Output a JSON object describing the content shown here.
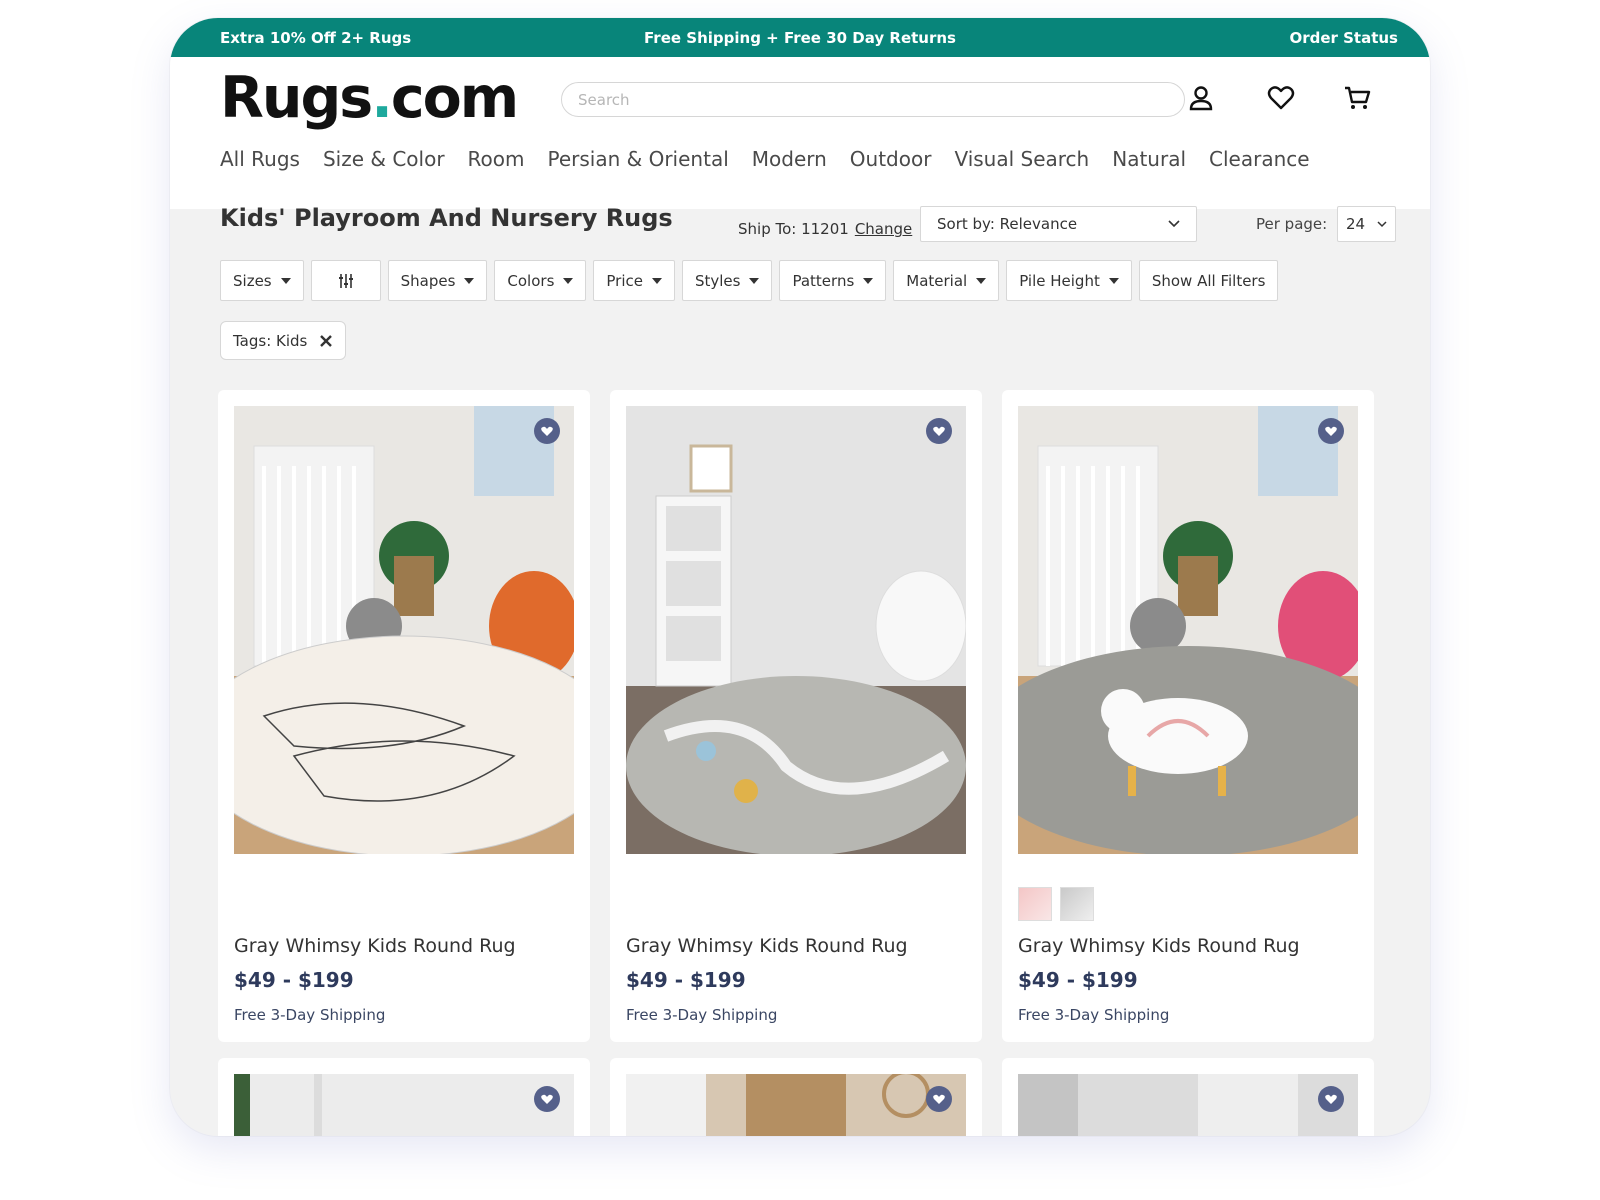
{
  "promo": {
    "left": "Extra 10% Off 2+ Rugs",
    "center": "Free Shipping + Free 30 Day Returns",
    "right": "Order Status"
  },
  "header": {
    "logo_main": "Rugs",
    "logo_dot": ".",
    "logo_tail": "com",
    "search_placeholder": "Search",
    "icons": [
      "account-icon",
      "heart-icon",
      "cart-icon"
    ]
  },
  "nav": [
    "All Rugs",
    "Size & Color",
    "Room",
    "Persian & Oriental",
    "Modern",
    "Outdoor",
    "Visual Search",
    "Natural",
    "Clearance"
  ],
  "toolbar": {
    "title": "Kids' Playroom And Nursery Rugs",
    "ship_to": "Ship To: 11201",
    "change": "Change",
    "sort": "Sort by: Relevance",
    "per_page_label": "Per page:",
    "per_page": "24"
  },
  "filters": [
    "Sizes",
    "Shapes",
    "Colors",
    "Price",
    "Styles",
    "Patterns",
    "Material",
    "Pile Height"
  ],
  "show_all_filters": "Show All Filters",
  "active_tag": "Tags: Kids",
  "colors": {
    "teal": "#08857a",
    "navy": "#2e3a5c",
    "fav": "#55608a"
  },
  "products": [
    {
      "name": "Gray Whimsy Kids Round Rug",
      "price": "$49 - $199",
      "shipping": "Free 3-Day Shipping"
    },
    {
      "name": "Gray Whimsy Kids Round Rug",
      "price": "$49 - $199",
      "shipping": "Free 3-Day Shipping"
    },
    {
      "name": "Gray Whimsy Kids Round Rug",
      "price": "$49 - $199",
      "shipping": "Free 3-Day Shipping"
    }
  ]
}
